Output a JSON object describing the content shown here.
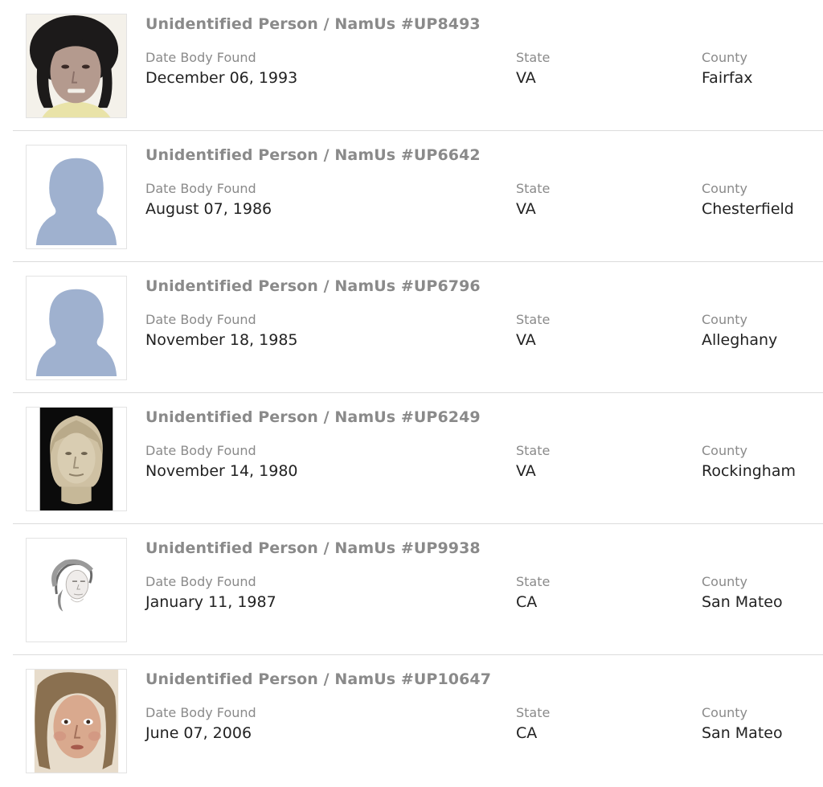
{
  "fields": {
    "date_label": "Date Body Found",
    "state_label": "State",
    "county_label": "County"
  },
  "cases": [
    {
      "title": "Unidentified Person / NamUs #UP8493",
      "date": "December 06, 1993",
      "state": "VA",
      "county": "Fairfax",
      "photo": "reconstruction-photo-dark-hair"
    },
    {
      "title": "Unidentified Person / NamUs #UP6642",
      "date": "August 07, 1986",
      "state": "VA",
      "county": "Chesterfield",
      "photo": "placeholder-silhouette"
    },
    {
      "title": "Unidentified Person / NamUs #UP6796",
      "date": "November 18, 1985",
      "state": "VA",
      "county": "Alleghany",
      "photo": "placeholder-silhouette"
    },
    {
      "title": "Unidentified Person / NamUs #UP6249",
      "date": "November 14, 1980",
      "state": "VA",
      "county": "Rockingham",
      "photo": "clay-bust-reconstruction"
    },
    {
      "title": "Unidentified Person / NamUs #UP9938",
      "date": "January 11, 1987",
      "state": "CA",
      "county": "San Mateo",
      "photo": "pencil-sketch"
    },
    {
      "title": "Unidentified Person / NamUs #UP10647",
      "date": "June 07, 2006",
      "state": "CA",
      "county": "San Mateo",
      "photo": "painted-portrait"
    }
  ],
  "colors": {
    "title_gray": "#8a8a8a",
    "value_text": "#222222",
    "divider": "#dcdcdc",
    "silhouette": "#9fb1cf"
  }
}
